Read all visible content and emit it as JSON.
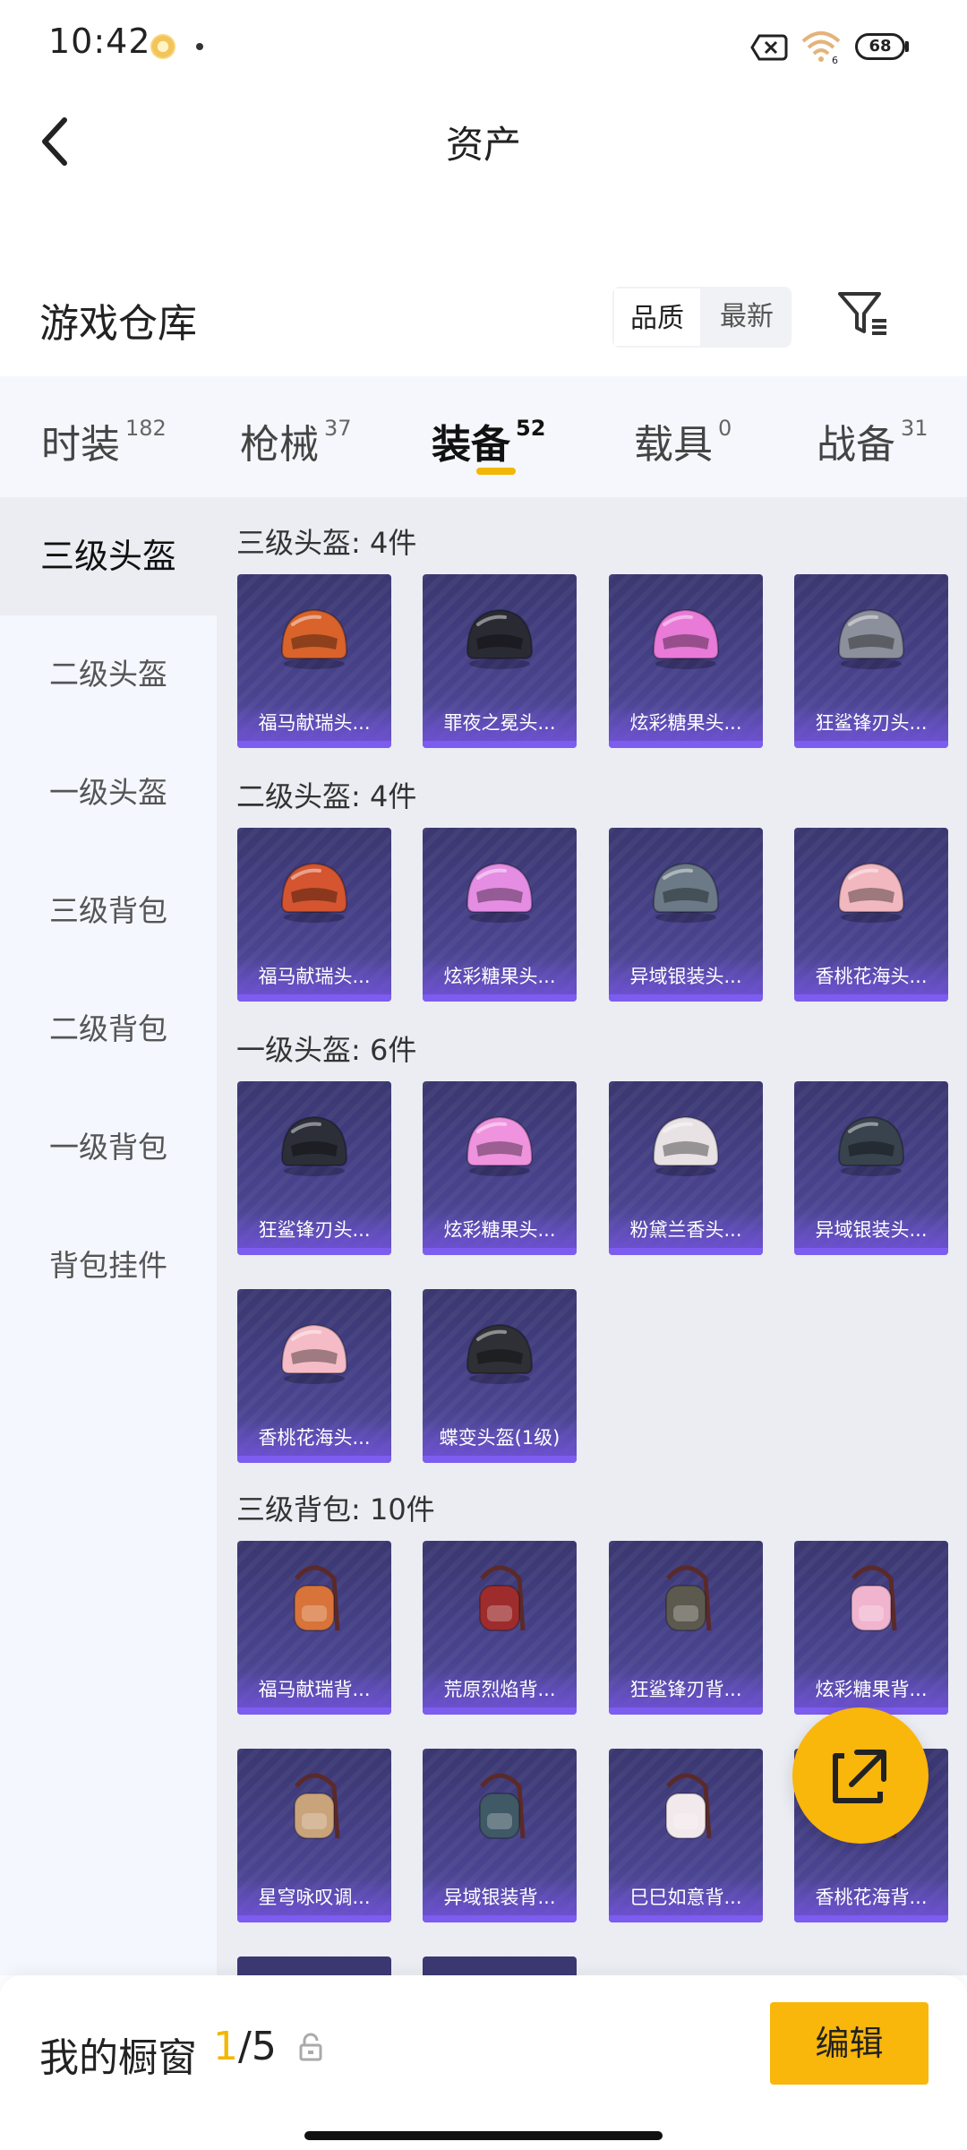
{
  "status_bar": {
    "time": "10:42",
    "battery": "68"
  },
  "header": {
    "title": "资产"
  },
  "warehouse": {
    "title": "游戏仓库",
    "sort_options": [
      "品质",
      "最新"
    ],
    "selected_sort": "品质"
  },
  "tabs": [
    {
      "label": "时装",
      "count": "182"
    },
    {
      "label": "枪械",
      "count": "37"
    },
    {
      "label": "装备",
      "count": "52",
      "active": true
    },
    {
      "label": "载具",
      "count": "0"
    },
    {
      "label": "战备",
      "count": "31"
    }
  ],
  "sidebar": {
    "items": [
      "三级头盔",
      "二级头盔",
      "一级头盔",
      "三级背包",
      "二级背包",
      "一级背包",
      "背包挂件"
    ],
    "active": "三级头盔"
  },
  "sections": [
    {
      "title": "三级头盔: 4件",
      "items": [
        {
          "name": "福马献瑞头...",
          "icon": "horse-helmet-art",
          "color": "#d9632a"
        },
        {
          "name": "罪夜之冕头...",
          "icon": "bat-helmet-art",
          "color": "#2a2a33"
        },
        {
          "name": "炫彩糖果头...",
          "icon": "candy-helmet-art",
          "color": "#e97ad8"
        },
        {
          "name": "狂鲨锋刃头...",
          "icon": "shark-helmet-art",
          "color": "#8c8f9c"
        }
      ]
    },
    {
      "title": "二级头盔: 4件",
      "items": [
        {
          "name": "福马献瑞头...",
          "icon": "orange-helmet-art",
          "color": "#d4552f"
        },
        {
          "name": "炫彩糖果头...",
          "icon": "candy-helmet-art",
          "color": "#e48de3"
        },
        {
          "name": "异域银装头...",
          "icon": "silver-helmet-art",
          "color": "#6b7a86"
        },
        {
          "name": "香桃花海头...",
          "icon": "peach-helmet-art",
          "color": "#f2b8bf"
        }
      ]
    },
    {
      "title": "一级头盔: 6件",
      "items": [
        {
          "name": "狂鲨锋刃头...",
          "icon": "black-helmet-art",
          "color": "#2c2f38"
        },
        {
          "name": "炫彩糖果头...",
          "icon": "candy-helmet-art",
          "color": "#ef93df"
        },
        {
          "name": "粉黛兰香头...",
          "icon": "white-helmet-art",
          "color": "#e8e2e4"
        },
        {
          "name": "异域银装头...",
          "icon": "dark-helmet-art",
          "color": "#39434d"
        },
        {
          "name": "香桃花海头...",
          "icon": "pink-helmet-art",
          "color": "#f5bcc7"
        },
        {
          "name": "蝶变头盔(1级)",
          "icon": "butterfly-helmet-art",
          "color": "#2f3035"
        }
      ]
    },
    {
      "title": "三级背包: 10件",
      "items": [
        {
          "name": "福马献瑞背...",
          "icon": "horse-backpack-art",
          "color": "#d8743a"
        },
        {
          "name": "荒原烈焰背...",
          "icon": "flame-backpack-art",
          "color": "#9e2c2c"
        },
        {
          "name": "狂鲨锋刃背...",
          "icon": "shark-backpack-art",
          "color": "#5c5a4e"
        },
        {
          "name": "炫彩糖果背...",
          "icon": "donut-backpack-art",
          "color": "#f0b4cf"
        },
        {
          "name": "星穹咏叹调...",
          "icon": "star-backpack-art",
          "color": "#c9a37a"
        },
        {
          "name": "异域银装背...",
          "icon": "silver-backpack-art",
          "color": "#3f5966"
        },
        {
          "name": "巳巳如意背...",
          "icon": "snake-backpack-art",
          "color": "#f1e9ec"
        },
        {
          "name": "香桃花海背...",
          "icon": "peach-backpack-art",
          "color": "#f2b0bf"
        }
      ]
    }
  ],
  "showcase": {
    "label": "我的橱窗",
    "current": "1",
    "total": "/5",
    "edit_label": "编辑"
  }
}
